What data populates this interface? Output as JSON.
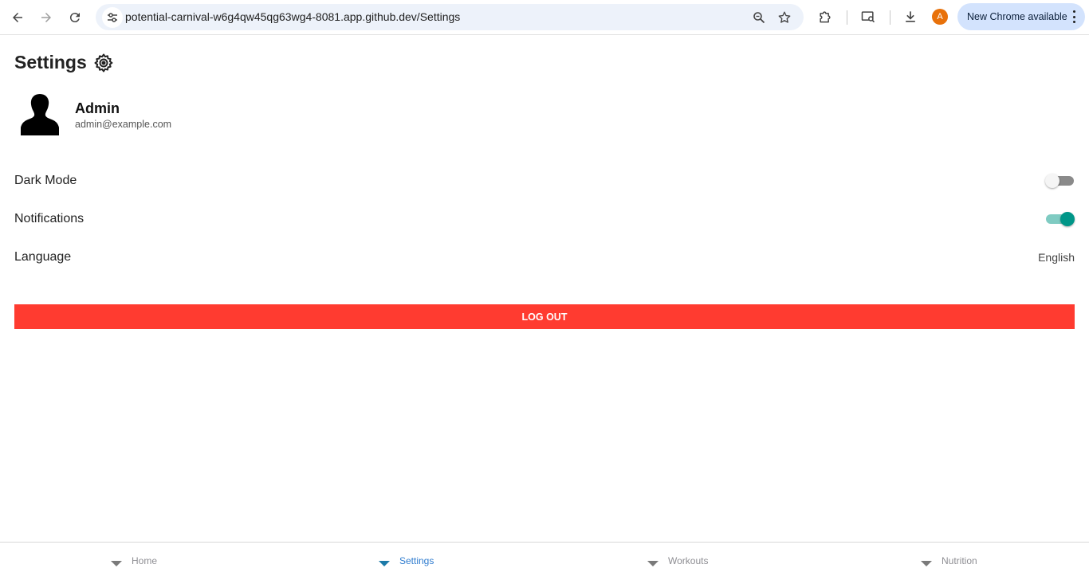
{
  "browser": {
    "url": "potential-carnival-w6g4qw45qg63wg4-8081.app.github.dev/Settings",
    "profile_initial": "A",
    "update_label": "New Chrome available"
  },
  "page": {
    "title": "Settings"
  },
  "profile": {
    "name": "Admin",
    "email": "admin@example.com"
  },
  "settings": {
    "dark_mode_label": "Dark Mode",
    "dark_mode_on": false,
    "notifications_label": "Notifications",
    "notifications_on": true,
    "language_label": "Language",
    "language_value": "English"
  },
  "logout_label": "LOG OUT",
  "colors": {
    "logout": "#ff3b30",
    "toggle_on": "#009688",
    "active_tab": "#2f7ccf"
  },
  "tabs": [
    {
      "label": "Home",
      "active": false
    },
    {
      "label": "Settings",
      "active": true
    },
    {
      "label": "Workouts",
      "active": false
    },
    {
      "label": "Nutrition",
      "active": false
    }
  ]
}
